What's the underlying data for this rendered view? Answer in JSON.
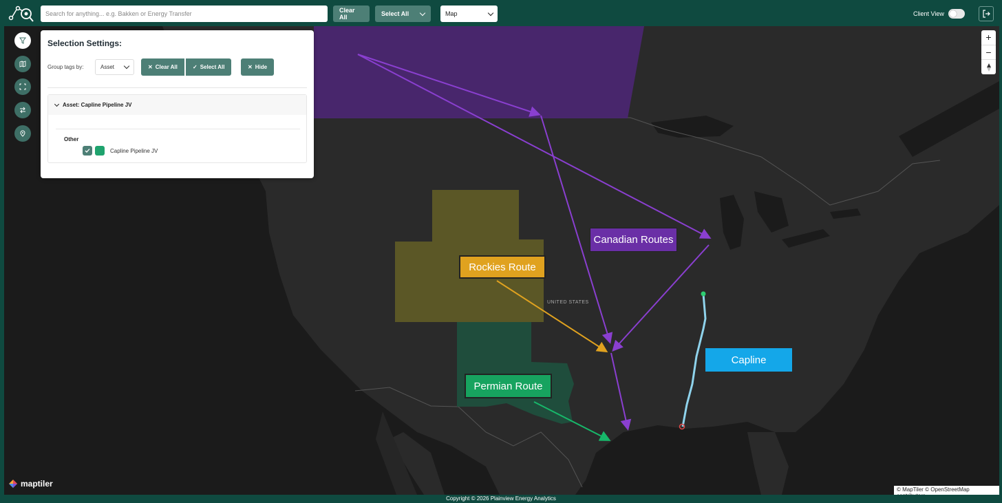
{
  "topbar": {
    "search_placeholder": "Search for anything... e.g. Bakken or Energy Transfer",
    "clear_all": "Clear All",
    "select_all": "Select All",
    "map_select": "Map",
    "client_view": "Client View",
    "client_view_on": false
  },
  "sidebar": {
    "icons": [
      "filter-icon",
      "map-icon",
      "expand-icon",
      "swap-icon",
      "location-pin-icon"
    ]
  },
  "panel": {
    "title": "Selection Settings:",
    "group_label": "Group tags by:",
    "group_value": "Asset",
    "clear_all": "Clear All",
    "select_all": "Select All",
    "hide": "Hide",
    "asset_header": "Asset: Capline Pipeline JV",
    "category": "Other",
    "item": {
      "label": "Capline Pipeline JV",
      "checked": true,
      "color": "#1fa36e"
    }
  },
  "map": {
    "country_label": "UNITED STATES",
    "labels": {
      "canadian": "Canadian Routes",
      "rockies": "Rockies Route",
      "permian": "Permian Route",
      "capline": "Capline"
    },
    "colors": {
      "canadian": "#6a2fa6",
      "rockies": "#e0a21f",
      "permian": "#17a35f",
      "capline": "#14a7e9",
      "capline_line": "#8fd3ec"
    },
    "brand": "maptiler",
    "attribution": "© MapTiler © OpenStreetMap contributors",
    "zoom_in": "+",
    "zoom_out": "−"
  },
  "footer": {
    "copyright": "Copyright © 2026 Plainview Energy Analytics"
  }
}
